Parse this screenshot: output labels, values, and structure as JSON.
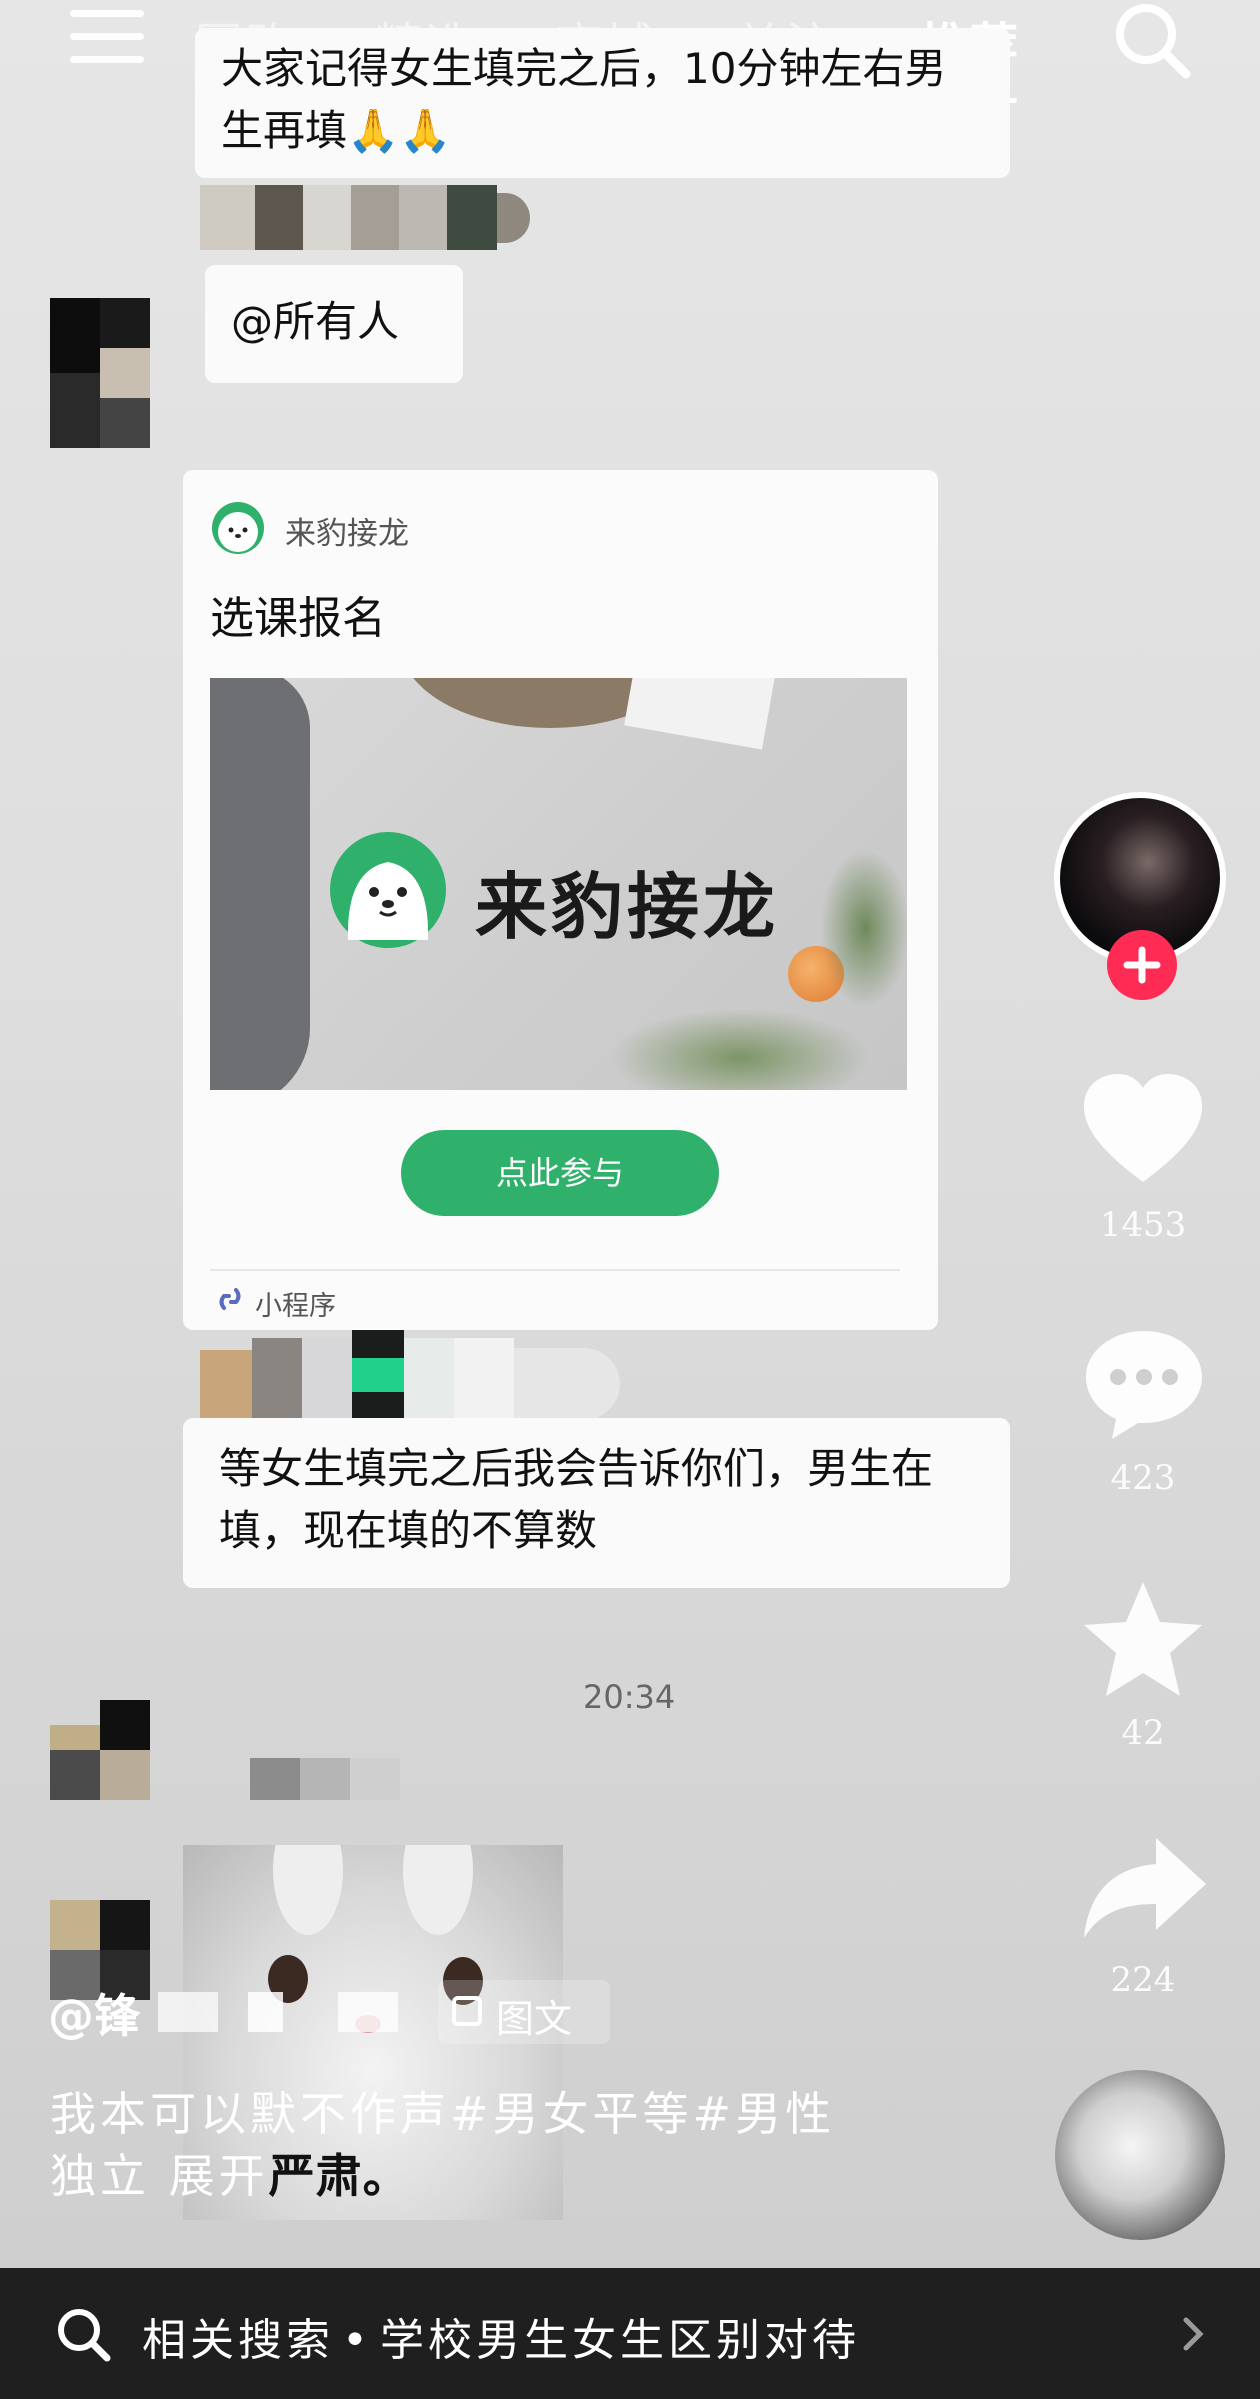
{
  "top_nav": {
    "tabs": [
      "团购",
      "精选",
      "商城",
      "关注",
      "推荐"
    ],
    "active_tab": "推荐"
  },
  "chat": {
    "msg1": "大家记得女生填完之后，10分钟左右男生再填🙏🙏",
    "msg2": "@所有人",
    "card": {
      "brand": "来豹接龙",
      "title": "选课报名",
      "banner_text": "来豹接龙",
      "cta": "点此参与",
      "footer": "小程序"
    },
    "msg3": "等女生填完之后我会告诉你们，男生在填，现在填的不算数",
    "timestamp": "20:34"
  },
  "rail": {
    "likes": "1453",
    "comments": "423",
    "favorites": "42",
    "shares": "224"
  },
  "post": {
    "author": "@锋",
    "type_badge": "图文",
    "caption_line1": "我本可以默不作声#男女平等#男性",
    "caption_line2": "独立 展开",
    "overlay_text": "严肃。"
  },
  "search": {
    "prefix": "相关搜索",
    "query": "学校男生女生区别对待"
  },
  "colors": {
    "cta_green": "#2fb06b",
    "follow_red": "#fe2c55"
  }
}
